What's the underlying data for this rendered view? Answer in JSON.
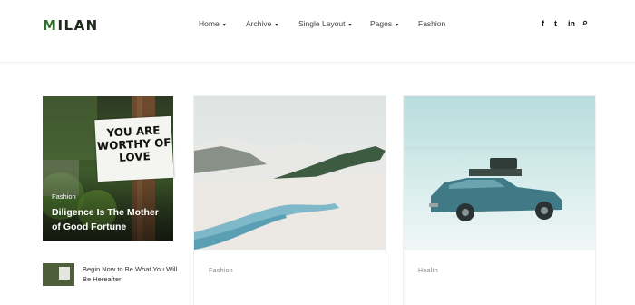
{
  "logo": {
    "first": "M",
    "rest": "ILAN"
  },
  "nav": {
    "items": [
      {
        "label": "Home",
        "has_dropdown": true
      },
      {
        "label": "Archive",
        "has_dropdown": true
      },
      {
        "label": "Single Layout",
        "has_dropdown": true
      },
      {
        "label": "Pages",
        "has_dropdown": true
      },
      {
        "label": "Fashion",
        "has_dropdown": false
      }
    ],
    "dropdown_glyph": "▾"
  },
  "social": {
    "facebook": "f",
    "twitter": "t",
    "linkedin": "in",
    "search": "⌕"
  },
  "featured": {
    "sign_text": "YOU ARE WORTHY OF LOVE",
    "category": "Fashion",
    "title": "Diligence Is The Mother of Good Fortune"
  },
  "recent": {
    "title": "Begin Now to Be What You Will Be Hereafter"
  },
  "cards": [
    {
      "category": "Fashion"
    },
    {
      "category": "Health"
    }
  ]
}
